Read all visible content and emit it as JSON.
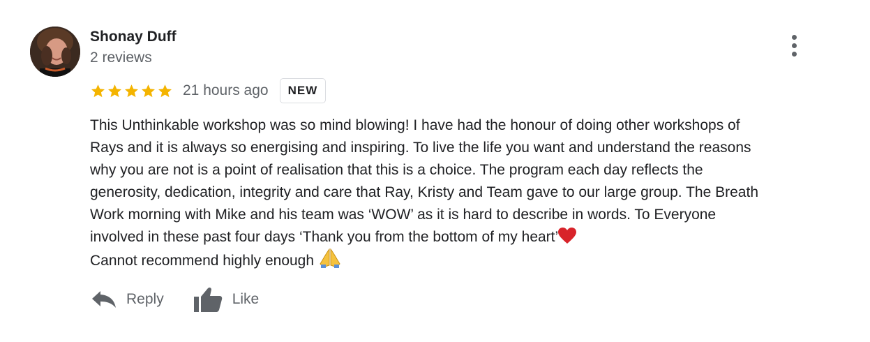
{
  "review": {
    "author": {
      "name": "Shonay Duff",
      "meta": "2 reviews"
    },
    "rating": {
      "stars": 5,
      "max_stars": 5,
      "star_color": "#f4b400"
    },
    "time": "21 hours ago",
    "badge": "NEW",
    "text_lines": [
      "This Unthinkable workshop was so mind blowing! I  have had the honour of doing other workshops of",
      "Rays and it is always so energising and inspiring. To live the life you want and understand the reasons",
      "why you are not is a point of realisation that this is a choice. The program each day reflects the",
      "generosity, dedication, integrity and care that Ray, Kristy and Team gave to our large group. The Breath",
      "Work morning with Mike and his team was ‘WOW’ as it is hard to describe in words. To Everyone",
      "involved in these past four days ‘Thank you from the bottom of my heart’",
      "Cannot recommend highly enough "
    ],
    "emojis": {
      "line6": "red-heart",
      "line7": "folded-hands"
    },
    "actions": {
      "reply_label": "Reply",
      "like_label": "Like"
    },
    "colors": {
      "text": "#202124",
      "secondary": "#5f6368",
      "badge_border": "#dadce0",
      "heart": "#d8232a"
    },
    "icons": {
      "more": "more-vert-icon",
      "reply": "reply-arrow-icon",
      "like": "thumb-up-icon",
      "star": "star-icon"
    }
  }
}
